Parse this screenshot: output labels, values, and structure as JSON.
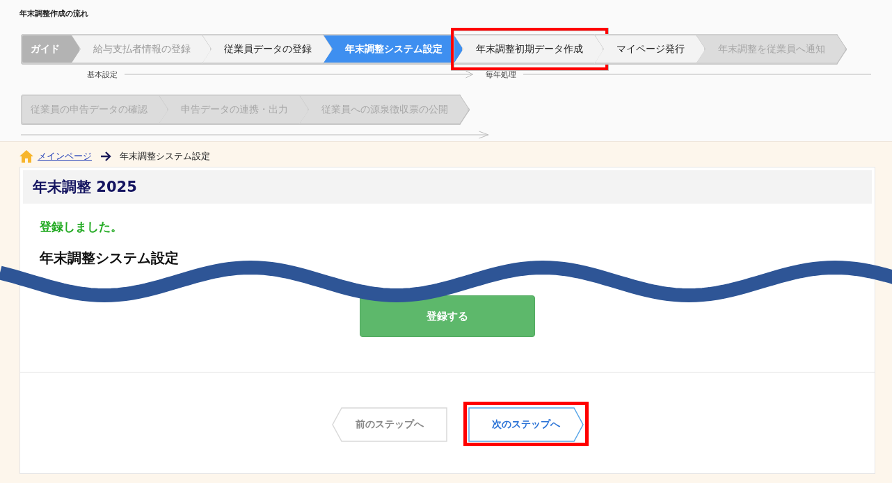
{
  "flow_title": "年末調整作成の流れ",
  "step_rows": [
    {
      "steps": [
        {
          "label": "ガイド",
          "kind": "guide",
          "highlighted": false
        },
        {
          "label": "給与支払者情報の登録",
          "kind": "muted",
          "highlighted": false
        },
        {
          "label": "従業員データの登録",
          "kind": "open",
          "highlighted": false
        },
        {
          "label": "年末調整システム設定",
          "kind": "current",
          "highlighted": false
        },
        {
          "label": "年末調整初期データ作成",
          "kind": "open",
          "highlighted": true
        },
        {
          "label": "マイページ発行",
          "kind": "open",
          "highlighted": false
        },
        {
          "label": "年末調整を従業員へ通知",
          "kind": "locked",
          "highlighted": false
        }
      ],
      "phases": [
        {
          "label": "基本設定",
          "arrow": true
        },
        {
          "label": "毎年処理",
          "arrow": false
        }
      ]
    },
    {
      "steps": [
        {
          "label": "従業員の申告データの確認",
          "kind": "locked",
          "highlighted": false
        },
        {
          "label": "申告データの連携・出力",
          "kind": "locked",
          "highlighted": false
        },
        {
          "label": "従業員への源泉徴収票の公開",
          "kind": "locked",
          "highlighted": false
        }
      ],
      "phases": [
        {
          "arrow": true
        }
      ]
    }
  ],
  "breadcrumb": {
    "link": "メインページ",
    "current": "年末調整システム設定"
  },
  "card": {
    "title": "年末調整 2025",
    "message": "登録しました。",
    "heading": "年末調整システム設定",
    "submit": "登録する"
  },
  "nav": [
    {
      "label": "前のステップへ",
      "kind": "prev",
      "highlighted": false
    },
    {
      "label": "次のステップへ",
      "kind": "next",
      "highlighted": true
    }
  ]
}
